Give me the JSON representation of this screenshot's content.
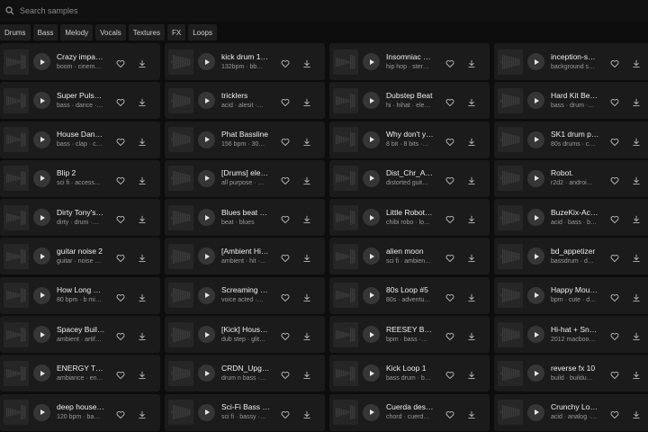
{
  "search": {
    "placeholder": "Search samples"
  },
  "tags": [
    "Drums",
    "Bass",
    "Melody",
    "Vocals",
    "Textures",
    "FX",
    "Loops"
  ],
  "samples": [
    {
      "title": "Crazy impa…",
      "tags": "boom · cinem…"
    },
    {
      "title": "kick drum 1…",
      "tags": "132bpm · bb…"
    },
    {
      "title": "Insomniac …",
      "tags": "hip hop · ster…"
    },
    {
      "title": "inception-s…",
      "tags": "background s…"
    },
    {
      "title": "Super Pulse…",
      "tags": "bass · dance ·…"
    },
    {
      "title": "tricklers",
      "tags": "acid · alesit ·…"
    },
    {
      "title": "Dubstep Beat",
      "tags": "hi · hihat · ele…"
    },
    {
      "title": "Hard Kit Be…",
      "tags": "bass · drum ·…"
    },
    {
      "title": "House Dan…",
      "tags": "bass · clap · c…"
    },
    {
      "title": "Phat Bassline",
      "tags": "156 bpm · 30…"
    },
    {
      "title": "Why don't y…",
      "tags": "8 bit · 8 bits ·…"
    },
    {
      "title": "SK1 drum p…",
      "tags": "80s drums · c…"
    },
    {
      "title": "Blip 2",
      "tags": "sci fi · access…"
    },
    {
      "title": "[Drums] ele…",
      "tags": "all purpose · …"
    },
    {
      "title": "Dist_Chr_A…",
      "tags": "distorted guit…"
    },
    {
      "title": "Robot.",
      "tags": "r2d2 · androi…"
    },
    {
      "title": "Dirty Tony's…",
      "tags": "dirty · drum ·…"
    },
    {
      "title": "Blues beat …",
      "tags": "beat · blues"
    },
    {
      "title": "Little Robot…",
      "tags": "chibi robo · lo…"
    },
    {
      "title": "BuzeKix-Aci…",
      "tags": "acid · bass · b…"
    },
    {
      "title": "guitar noise 2",
      "tags": "guitar · noise …"
    },
    {
      "title": "[Ambient Hi…",
      "tags": "ambient · hit ·…"
    },
    {
      "title": "alien moon",
      "tags": "sci fi · ambien…"
    },
    {
      "title": "bd_appetizer",
      "tags": "bassdrum · d…"
    },
    {
      "title": "How Long …",
      "tags": "80 bpm · b mi…"
    },
    {
      "title": "Screaming …",
      "tags": "voice acted ·…"
    },
    {
      "title": "80s Loop #5",
      "tags": "80s · adventu…"
    },
    {
      "title": "Happy Mou…",
      "tags": "bpm · cute · d…"
    },
    {
      "title": "Spacey Buil…",
      "tags": "ambient · artif…"
    },
    {
      "title": "[Kick] Hous…",
      "tags": "dub step · glit…"
    },
    {
      "title": "REESEY BA…",
      "tags": "bpm · bass ·…"
    },
    {
      "title": "Hi-hat + Sn…",
      "tags": "2012 macboo…"
    },
    {
      "title": "ENERGY TE…",
      "tags": "ambiance · en…"
    },
    {
      "title": "CRDN_Upg…",
      "tags": "drum n bass ·…"
    },
    {
      "title": "Kick Loop 1",
      "tags": "bass drum · b…"
    },
    {
      "title": "reverse fx 10",
      "tags": "build · buildu…"
    },
    {
      "title": "deep house…",
      "tags": "120 bpm · ba…"
    },
    {
      "title": "Sci-Fi Bass …",
      "tags": "sci fi · bassy ·…"
    },
    {
      "title": "Cuerda des…",
      "tags": "chord · cuerd…"
    },
    {
      "title": "Crunchy Lo…",
      "tags": "acid · analog ·…"
    }
  ]
}
